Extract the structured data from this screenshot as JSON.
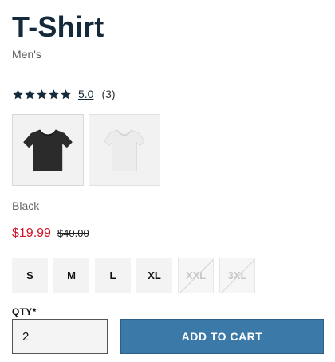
{
  "product": {
    "title": "T-Shirt",
    "subtitle": "Men's"
  },
  "rating": {
    "stars": 5,
    "value_text": "5.0",
    "count_text": "(3)",
    "star_color": "#14293a"
  },
  "swatches": [
    {
      "name": "black-tshirt-swatch",
      "shirt_color": "#2b2b2b",
      "selected": true
    },
    {
      "name": "white-tshirt-swatch",
      "shirt_color": "#ececec",
      "selected": false
    }
  ],
  "selected_color": "Black",
  "price": {
    "sale": "$19.99",
    "original": "$40.00",
    "sale_color": "#d0152a"
  },
  "sizes": [
    {
      "label": "S",
      "available": true
    },
    {
      "label": "M",
      "available": true
    },
    {
      "label": "L",
      "available": true
    },
    {
      "label": "XL",
      "available": true
    },
    {
      "label": "XXL",
      "available": false
    },
    {
      "label": "3XL",
      "available": false
    }
  ],
  "qty": {
    "label": "QTY*",
    "value": "2"
  },
  "add_to_cart": {
    "label": "ADD TO CART",
    "color": "#3a79a8"
  }
}
